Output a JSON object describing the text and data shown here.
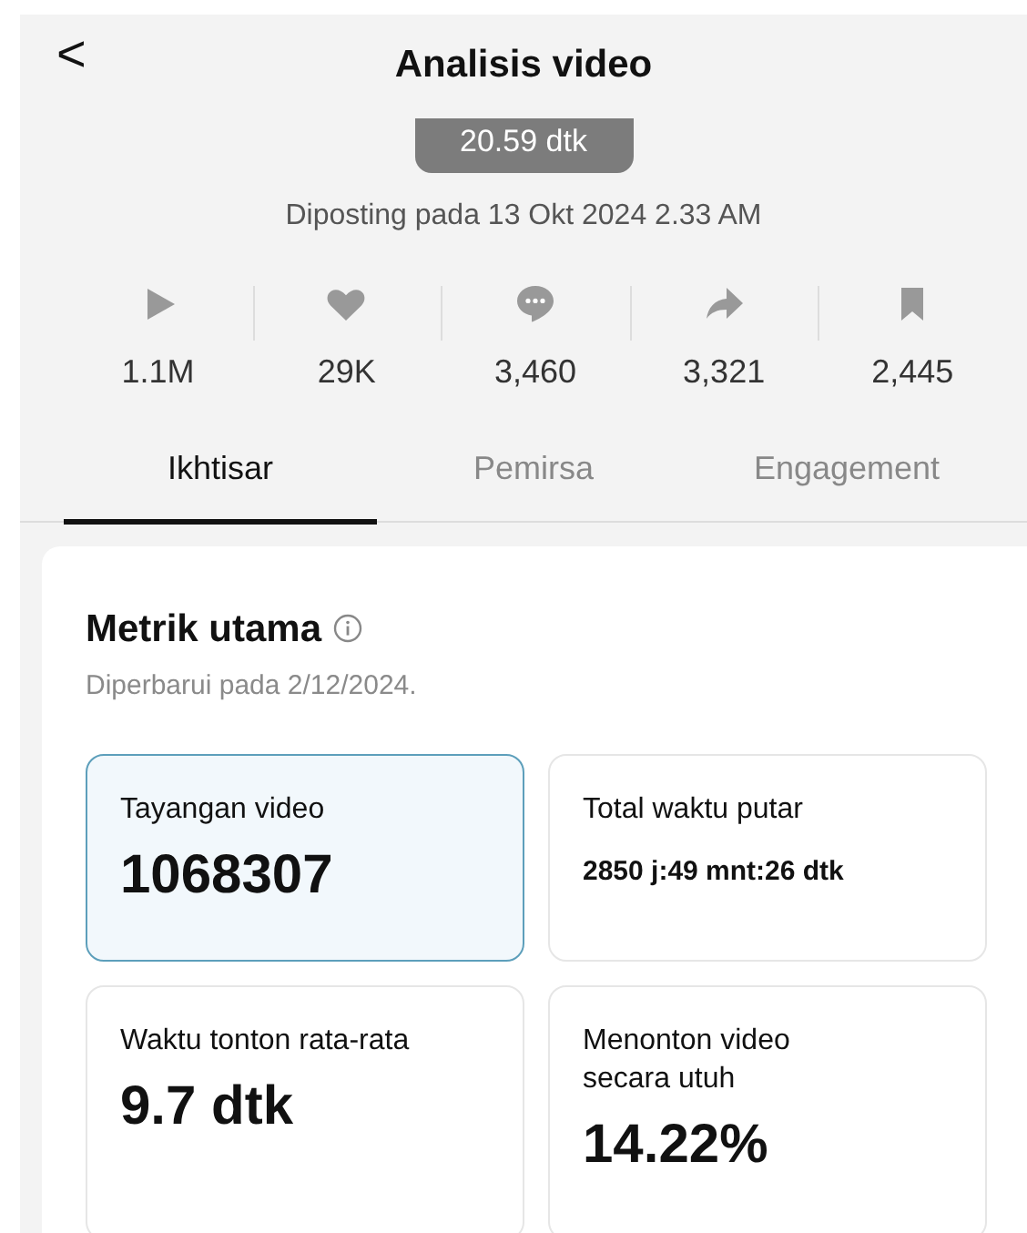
{
  "header": {
    "back": "<",
    "title": "Analisis video"
  },
  "duration": "20.59 dtk",
  "posted": "Diposting pada 13 Okt 2024 2.33 AM",
  "stats": [
    {
      "kind": "views",
      "count": "1.1M"
    },
    {
      "kind": "likes",
      "count": "29K"
    },
    {
      "kind": "comments",
      "count": "3,460"
    },
    {
      "kind": "shares",
      "count": "3,321"
    },
    {
      "kind": "saves",
      "count": "2,445"
    }
  ],
  "tabs": [
    {
      "label": "Ikhtisar",
      "selected": true
    },
    {
      "label": "Pemirsa",
      "selected": false
    },
    {
      "label": "Engagement",
      "selected": false
    }
  ],
  "section": {
    "title": "Metrik utama",
    "updated": "Diperbarui pada 2/12/2024.",
    "metrics": [
      {
        "label": "Tayangan video",
        "value": "1068307",
        "kind": "large",
        "selected": true
      },
      {
        "label": "Total waktu putar",
        "value": "2850 j:49 mnt:26 dtk",
        "kind": "small",
        "selected": false
      },
      {
        "label": "Waktu tonton rata-rata",
        "value": "9.7 dtk",
        "kind": "large",
        "selected": false
      },
      {
        "label": "Menonton video secara utuh",
        "value": "14.22%",
        "kind": "large",
        "selected": false
      }
    ]
  }
}
